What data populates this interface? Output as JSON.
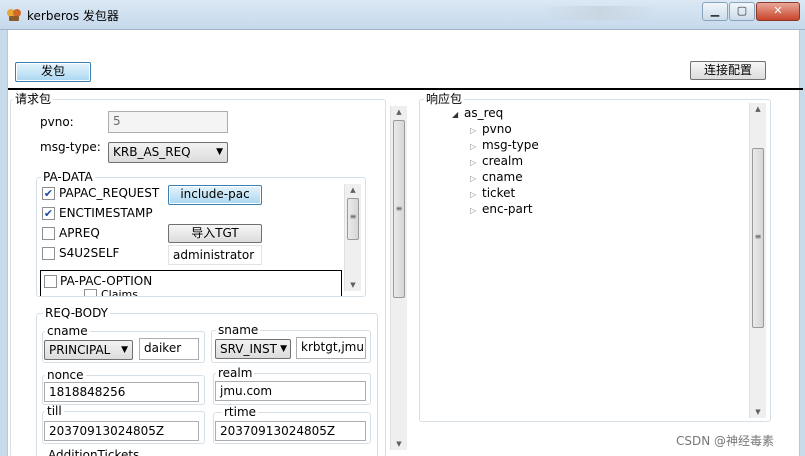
{
  "window": {
    "title": "kerberos 发包器"
  },
  "toolbar": {
    "send_label": "发包",
    "connect_label": "连接配置"
  },
  "request": {
    "group_label": "请求包",
    "pvno_label": "pvno:",
    "pvno_value": "5",
    "msgtype_label": "msg-type:",
    "msgtype_value": "KRB_AS_REQ",
    "padata": {
      "label": "PA-DATA",
      "items": [
        {
          "label": "PAPAC_REQUEST",
          "checked": true
        },
        {
          "label": "ENCTIMESTAMP",
          "checked": true
        },
        {
          "label": "APREQ",
          "checked": false
        },
        {
          "label": "S4U2SELF",
          "checked": false
        }
      ],
      "include_pac_label": "include-pac",
      "import_tgt_label": "导入TGT",
      "user_value": "administrator",
      "pac_option_label": "PA-PAC-OPTION",
      "pac_sub_label": "Claims"
    },
    "reqbody": {
      "label": "REQ-BODY",
      "cname_label": "cname",
      "cname_type": "PRINCIPAL",
      "cname_value": "daiker",
      "sname_label": "sname",
      "sname_type": "SRV_INST",
      "sname_value": "krbtgt,jmu",
      "nonce_label": "nonce",
      "nonce_value": "1818848256",
      "realm_label": "realm",
      "realm_value": "jmu.com",
      "till_label": "till",
      "till_value": "20370913024805Z",
      "rtime_label": "rtime",
      "rtime_value": "20370913024805Z",
      "more_label": "AdditionTickets"
    }
  },
  "response": {
    "group_label": "响应包",
    "root": "as_req",
    "children": [
      "pvno",
      "msg-type",
      "crealm",
      "cname",
      "ticket",
      "enc-part"
    ]
  },
  "watermark": "CSDN @神经毒素"
}
